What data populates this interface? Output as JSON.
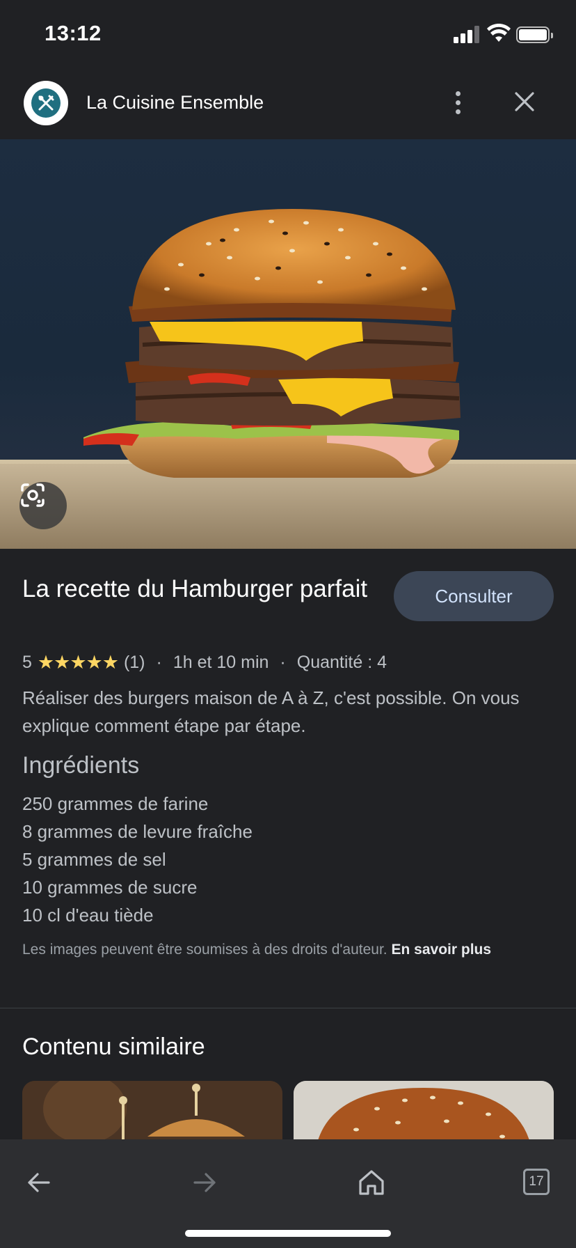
{
  "status_bar": {
    "time": "13:12"
  },
  "header": {
    "site_name": "La Cuisine Ensemble"
  },
  "hero": {
    "alt": "burger-photo"
  },
  "recipe": {
    "title": "La recette du Hamburger parfait",
    "consult_label": "Consulter",
    "rating_value": "5",
    "stars": "★★★★★",
    "rating_count": "(1)",
    "separator": "·",
    "duration": "1h et 10 min",
    "quantity": "Quantité : 4",
    "description": "Réaliser des burgers maison de A à Z, c'est possible. On vous explique comment étape par étape."
  },
  "ingredients": {
    "heading": "Ingrédients",
    "items": [
      "250 grammes de farine",
      "8 grammes de levure fraîche",
      "5 grammes de sel",
      "10 grammes de sucre",
      "10 cl d'eau tiède"
    ]
  },
  "copyright": {
    "text": "Les images peuvent être soumises à des droits d'auteur. ",
    "link": "En savoir plus"
  },
  "similar": {
    "heading": "Contenu similaire"
  },
  "toolbar": {
    "tab_count": "17"
  },
  "colors": {
    "background": "#202124",
    "accent_button": "#3c4656",
    "star": "#fdd663"
  }
}
